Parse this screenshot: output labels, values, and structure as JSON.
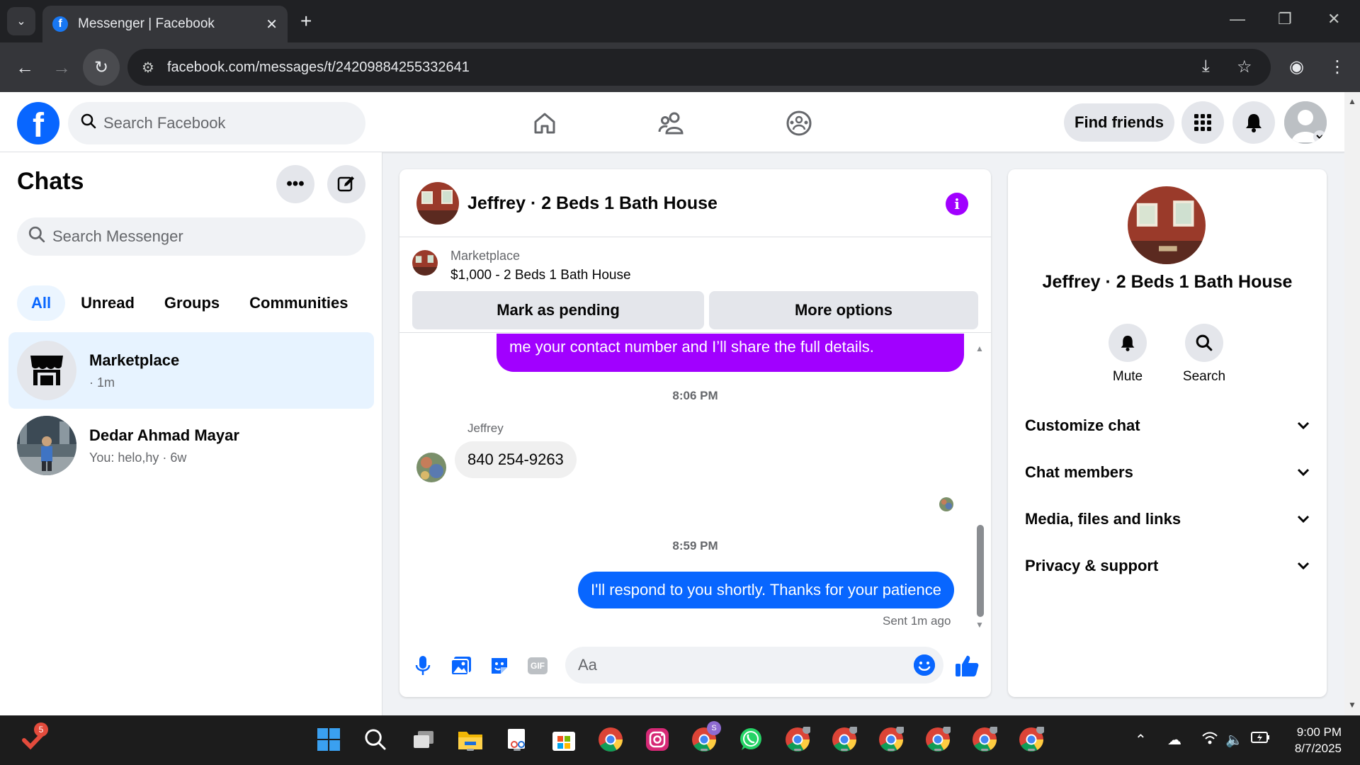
{
  "browser": {
    "tab_title": "Messenger | Facebook",
    "favicon_letter": "f",
    "url": "facebook.com/messages/t/24209884255332641"
  },
  "header": {
    "search_placeholder": "Search Facebook",
    "find_friends": "Find friends",
    "logo_letter": "f"
  },
  "chats": {
    "title": "Chats",
    "more_glyph": "•••",
    "search_placeholder": "Search Messenger",
    "filters": [
      "All",
      "Unread",
      "Groups",
      "Communities"
    ],
    "active_filter": "All",
    "items": [
      {
        "name": "Marketplace",
        "preview": "· 1m",
        "active": true
      },
      {
        "name": "Dedar Ahmad Mayar",
        "preview": "You: helo,hy · 6w",
        "active": false
      }
    ]
  },
  "conversation": {
    "title": "Jeffrey · 2 Beds 1 Bath House",
    "marketplace_label": "Marketplace",
    "listing": "$1,000 - 2 Beds 1 Bath House",
    "mark_pending": "Mark as pending",
    "more_options": "More options",
    "messages": {
      "outgoing_partial": "me your contact number and I’ll share the full details.",
      "time1": "8:06 PM",
      "sender": "Jeffrey",
      "incoming": "840 254-9263",
      "time2": "8:59 PM",
      "outgoing": "I'll respond to you shortly. Thanks for your patience",
      "status": "Sent 1m ago"
    },
    "composer_placeholder": "Aa",
    "gif_label": "GIF"
  },
  "info_panel": {
    "name": "Jeffrey · 2 Beds 1 Bath House",
    "actions": [
      "Mute",
      "Search"
    ],
    "sections": [
      "Customize chat",
      "Chat members",
      "Media, files and links",
      "Privacy & support"
    ]
  },
  "taskbar": {
    "notif_badge": "5",
    "chrome_badge": "S",
    "time": "9:00 PM",
    "date": "8/7/2025"
  },
  "colors": {
    "fb_blue": "#0866ff",
    "purple": "#a100ff",
    "chrome_dark": "#202124"
  }
}
